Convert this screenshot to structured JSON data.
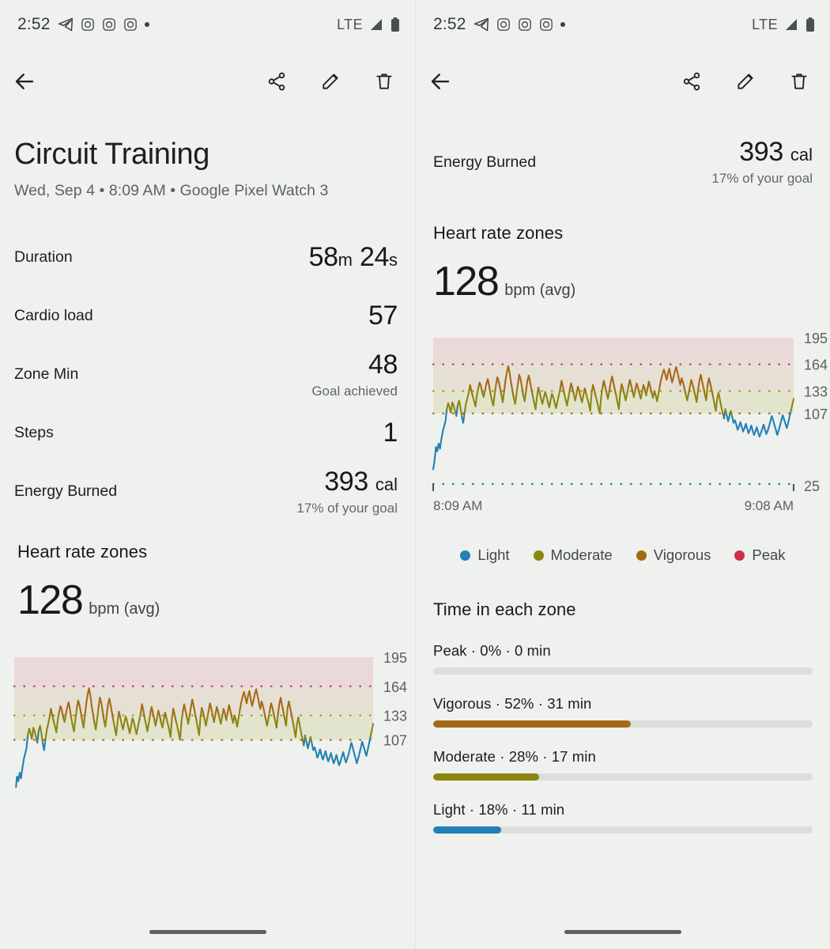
{
  "status_bar": {
    "time": "2:52",
    "network": "LTE",
    "icons": [
      "telegram-icon",
      "instagram-icon",
      "instagram-icon",
      "instagram-icon",
      "more-dot-icon"
    ],
    "right_icons": [
      "signal-icon",
      "battery-icon"
    ]
  },
  "app_bar": {
    "back": "back-arrow",
    "share": "share",
    "edit": "edit",
    "delete": "delete"
  },
  "workout": {
    "title": "Circuit Training",
    "subtitle": "Wed, Sep 4 • 8:09 AM • Google Pixel Watch 3"
  },
  "stats": [
    {
      "label": "Duration",
      "value": "58",
      "unit": "m",
      "value2": "24",
      "unit2": "s",
      "sub": ""
    },
    {
      "label": "Cardio load",
      "value": "57",
      "unit": "",
      "sub": ""
    },
    {
      "label": "Zone Min",
      "value": "48",
      "unit": "",
      "sub": "Goal achieved"
    },
    {
      "label": "Steps",
      "value": "1",
      "unit": "",
      "sub": ""
    },
    {
      "label": "Energy Burned",
      "value": "393",
      "unit": "cal",
      "sub": "17% of your goal"
    }
  ],
  "heart_rate": {
    "section_title": "Heart rate zones",
    "avg_value": "128",
    "avg_unit": "bpm (avg)"
  },
  "time_in_zone": {
    "section_title": "Time in each zone",
    "rows": [
      {
        "name": "Peak",
        "text": "Peak · 0% · 0 min",
        "percent": 0,
        "minutes": 0,
        "color": "#cf2e4e"
      },
      {
        "name": "Vigorous",
        "text": "Vigorous · 52% · 31 min",
        "percent": 52,
        "minutes": 31,
        "color": "#a56a17"
      },
      {
        "name": "Moderate",
        "text": "Moderate · 28% · 17 min",
        "percent": 28,
        "minutes": 17,
        "color": "#8c8611"
      },
      {
        "name": "Light",
        "text": "Light · 18% · 11 min",
        "percent": 18,
        "minutes": 11,
        "color": "#2280b5"
      }
    ]
  },
  "legend": [
    {
      "label": "Light",
      "color": "#2280b5"
    },
    {
      "label": "Moderate",
      "color": "#8c8611"
    },
    {
      "label": "Vigorous",
      "color": "#a56a17"
    },
    {
      "label": "Peak",
      "color": "#cf2e4e"
    }
  ],
  "chart_data": {
    "type": "line",
    "title": "Heart rate zones",
    "xlabel": "",
    "ylabel": "bpm",
    "grid": true,
    "legend_position": "bottom",
    "x_start_label": "8:09 AM",
    "x_end_label": "9:08 AM",
    "y_ticks": [
      195,
      164,
      133,
      107,
      25
    ],
    "ylim": [
      25,
      195
    ],
    "zone_bands": [
      {
        "name": "Peak",
        "from": 164,
        "to": 195,
        "fill": "#ead9d9",
        "boundary_value": 164,
        "boundary_color": "#c9405f"
      },
      {
        "name": "Vigorous",
        "from": 133,
        "to": 164,
        "fill": "#e6e0d4",
        "boundary_value": 133,
        "boundary_color": "#8c8611"
      },
      {
        "name": "Moderate",
        "from": 107,
        "to": 133,
        "fill": "#e4e4cf",
        "boundary_value": 107,
        "boundary_color": "#a56a17"
      },
      {
        "name": "Light",
        "from": 25,
        "to": 107,
        "fill": "none",
        "boundary_value": 25,
        "boundary_color": "#2280b5"
      }
    ],
    "series": [
      {
        "name": "Heart rate",
        "zone_colors": {
          "Light": "#2280b5",
          "Moderate": "#8c8611",
          "Vigorous": "#a56a17",
          "Peak": "#cf2e4e"
        },
        "values": [
          42,
          52,
          68,
          63,
          72,
          66,
          77,
          86,
          92,
          98,
          112,
          119,
          114,
          108,
          120,
          116,
          110,
          104,
          117,
          122,
          114,
          103,
          96,
          108,
          118,
          124,
          131,
          140,
          133,
          127,
          121,
          115,
          128,
          136,
          143,
          139,
          131,
          126,
          134,
          142,
          147,
          139,
          130,
          122,
          116,
          129,
          140,
          149,
          144,
          136,
          128,
          120,
          133,
          146,
          155,
          162,
          154,
          143,
          134,
          125,
          118,
          129,
          141,
          152,
          147,
          138,
          128,
          121,
          133,
          145,
          151,
          143,
          135,
          127,
          119,
          112,
          126,
          137,
          131,
          124,
          118,
          125,
          132,
          127,
          120,
          114,
          122,
          130,
          126,
          119,
          113,
          121,
          128,
          135,
          145,
          138,
          130,
          123,
          116,
          125,
          134,
          142,
          136,
          129,
          122,
          130,
          138,
          133,
          126,
          120,
          128,
          136,
          130,
          124,
          118,
          110,
          130,
          140,
          134,
          127,
          121,
          114,
          107,
          126,
          137,
          145,
          138,
          131,
          124,
          133,
          142,
          150,
          143,
          135,
          128,
          120,
          112,
          131,
          141,
          136,
          129,
          122,
          130,
          138,
          146,
          140,
          133,
          126,
          134,
          142,
          137,
          130,
          124,
          132,
          140,
          135,
          128,
          136,
          144,
          138,
          131,
          125,
          133,
          128,
          121,
          130,
          139,
          147,
          153,
          158,
          152,
          146,
          154,
          159,
          150,
          143,
          149,
          156,
          161,
          154,
          147,
          140,
          148,
          143,
          136,
          129,
          122,
          130,
          138,
          146,
          141,
          134,
          127,
          120,
          134,
          145,
          152,
          144,
          137,
          129,
          122,
          140,
          148,
          141,
          134,
          126,
          118,
          110,
          124,
          131,
          123,
          115,
          108,
          101,
          112,
          105,
          98,
          104,
          110,
          103,
          96,
          99,
          94,
          88,
          92,
          97,
          91,
          86,
          90,
          95,
          89,
          84,
          88,
          93,
          87,
          82,
          86,
          91,
          85,
          80,
          84,
          89,
          94,
          88,
          83,
          87,
          92,
          98,
          104,
          99,
          93,
          88,
          82,
          87,
          93,
          99,
          105,
          100,
          95,
          90,
          96,
          103,
          110,
          117,
          124
        ]
      }
    ]
  },
  "nav": {
    "pill": "home-indicator"
  }
}
